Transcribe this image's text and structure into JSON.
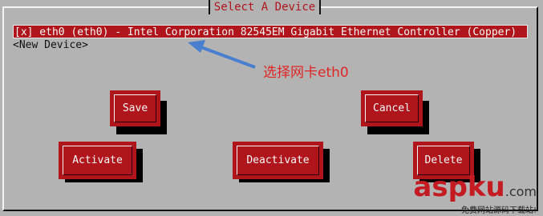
{
  "dialog": {
    "title": "Select A Device"
  },
  "devices": [
    {
      "label": "[x] eth0 (eth0) - Intel Corporation 82545EM Gigabit Ethernet Controller (Copper)",
      "selected": true
    },
    {
      "label": "<New Device>",
      "selected": false
    }
  ],
  "buttons": {
    "save": "Save",
    "cancel": "Cancel",
    "activate": "Activate",
    "deactivate": "Deactivate",
    "delete": "Delete"
  },
  "annotation": {
    "text": "选择网卡eth0",
    "color": "#e02525",
    "arrow_color": "#4a7fd0"
  },
  "watermark": {
    "brand": "aspku",
    "suffix": ".com",
    "subtitle": "免费网站源码下载站!"
  },
  "colors": {
    "background": "#b3b3b3",
    "accent": "#b0151c"
  }
}
